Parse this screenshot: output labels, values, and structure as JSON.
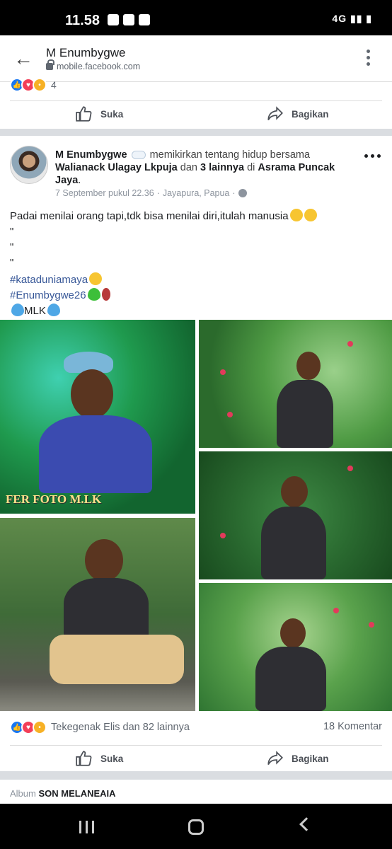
{
  "status_bar": {
    "time": "11.58",
    "network": "4G"
  },
  "browser": {
    "title": "M Enumbygwe",
    "url": "mobile.facebook.com"
  },
  "prev_post": {
    "reaction_count": "4",
    "like_label": "Suka",
    "share_label": "Bagikan"
  },
  "post": {
    "author": "M Enumbygwe",
    "activity_text": "memikirkan tentang hidup bersama",
    "tagged_user": "Walianack Ulagay Lkpuja",
    "and_text": "dan",
    "others": "3 lainnya",
    "in_text": "di",
    "location": "Asrama Puncak Jaya",
    "date": "7 September pukul 22.36",
    "place": "Jayapura, Papua",
    "separator": "·",
    "body_main": "Padai menilai orang tapi,tdk bisa menilai diri,itulah manusia",
    "quote_marks": [
      "\"",
      "\"",
      "\""
    ],
    "hashtag1": "#kataduniamaya",
    "hashtag2": "#Enumbygwe26",
    "mlk_text": "MLK",
    "watermark": "FER FOTO M.LK",
    "reactions_text": "Tekegenak Elis dan 82 lainnya",
    "comments": "18 Komentar",
    "like_label": "Suka",
    "share_label": "Bagikan"
  },
  "album": {
    "label": "Album",
    "name": "SON MELANEAIA"
  }
}
